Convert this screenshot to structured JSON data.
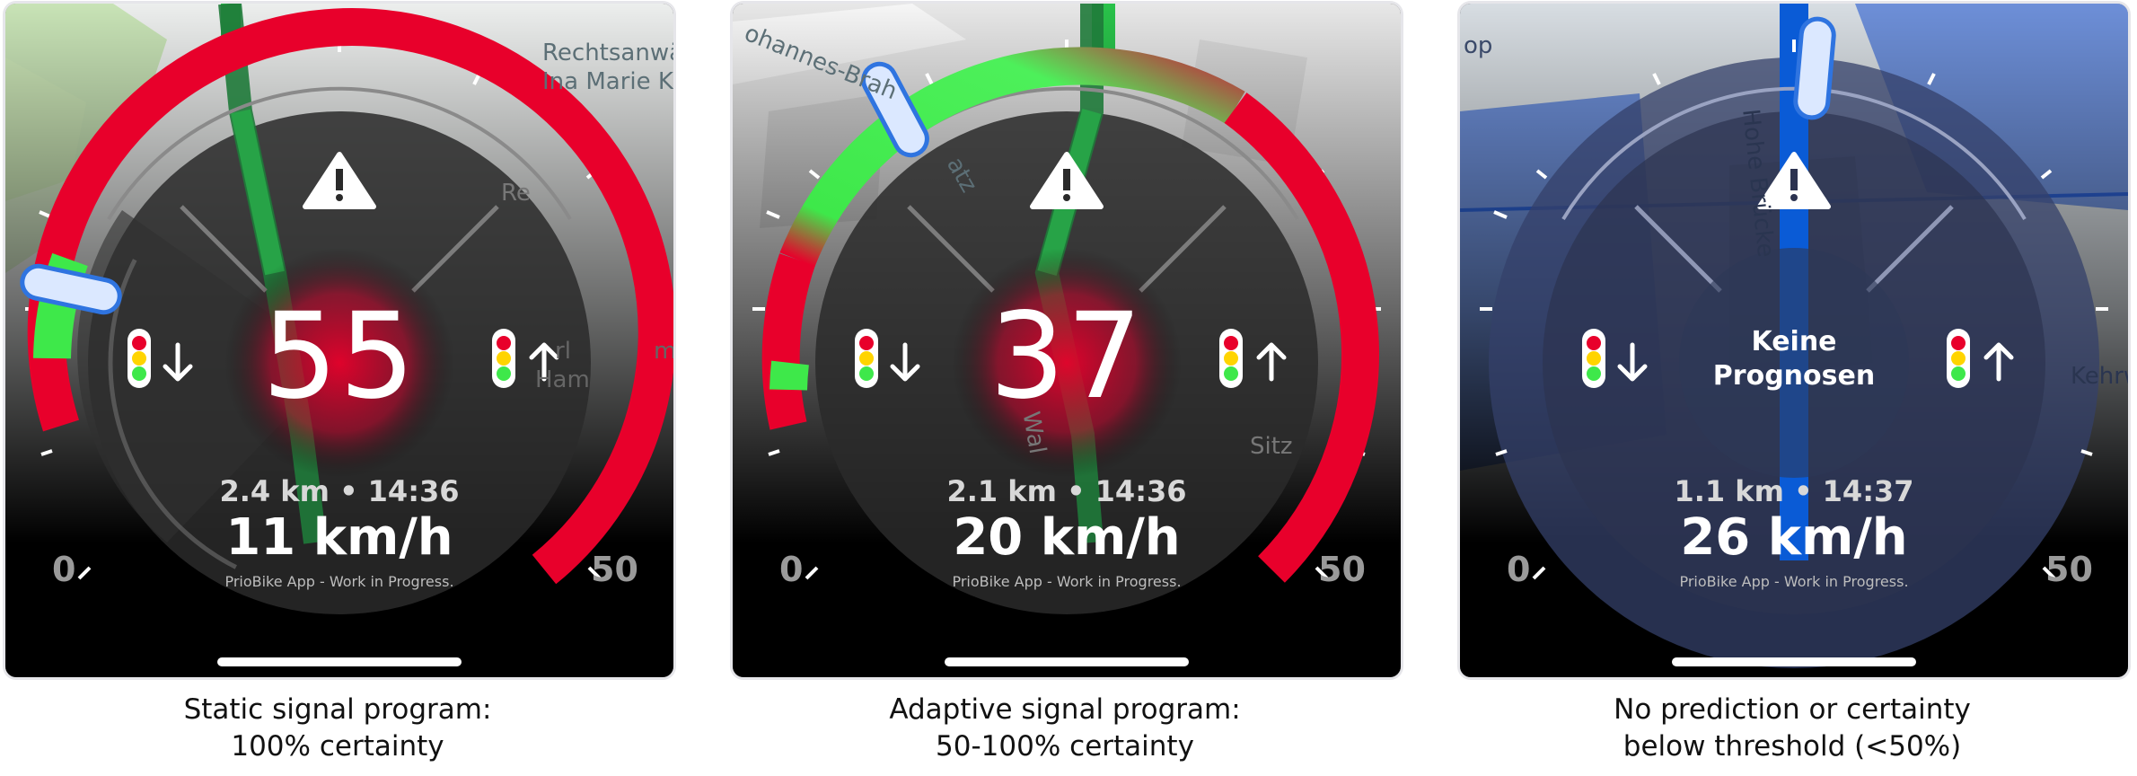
{
  "panels": [
    {
      "map_labels": [
        "Rechtsanwält",
        "Ina Marie Kop",
        "Re",
        "rl",
        "m",
        "Ham"
      ],
      "countdown": "55",
      "prediction_text": "",
      "distance_eta": "2.4 km • 14:36",
      "speed": "11 km/h",
      "credit": "PrioBike App - Work in Progress.",
      "scale_min": "0",
      "scale_max": "50",
      "caption_line1": "Static signal program:",
      "caption_line2": "100% certainty"
    },
    {
      "map_labels": [
        "ohannes-Brah",
        "atz",
        "Wal",
        "Sitz"
      ],
      "countdown": "37",
      "prediction_text": "",
      "distance_eta": "2.1 km • 14:36",
      "speed": "20 km/h",
      "credit": "PrioBike App - Work in Progress.",
      "scale_min": "0",
      "scale_max": "50",
      "caption_line1": "Adaptive signal program:",
      "caption_line2": "50-100% certainty"
    },
    {
      "map_labels": [
        "op",
        "Hohe Brücke",
        "Kehrw"
      ],
      "countdown": "",
      "prediction_text": "Keine\nPrognosen",
      "prediction_line1": "Keine",
      "prediction_line2": "Prognosen",
      "distance_eta": "1.1 km • 14:37",
      "speed": "26 km/h",
      "credit": "PrioBike App - Work in Progress.",
      "scale_min": "0",
      "scale_max": "50",
      "caption_line1": "No prediction or certainty",
      "caption_line2": "below threshold (<50%)"
    }
  ],
  "icons": {
    "warning": "warning-triangle-icon",
    "previous_signal": "traffic-light-down-arrow-icon",
    "next_signal": "traffic-light-up-arrow-icon"
  },
  "colors": {
    "red": "#e8002b",
    "green": "#3ee84a",
    "blue_route": "#0a5bd6",
    "needle": "#d9e8ff"
  }
}
